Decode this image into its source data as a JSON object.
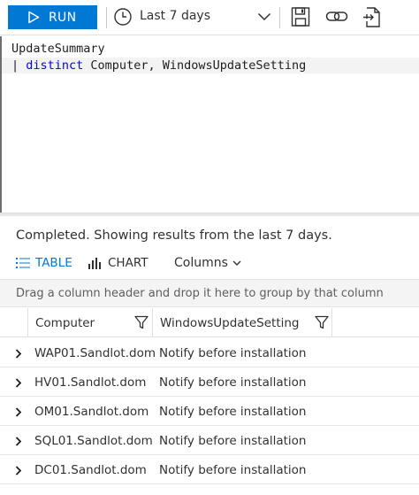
{
  "toolbar": {
    "run_label": "RUN",
    "time_range": "Last 7 days",
    "icons": [
      "play-icon",
      "clock-icon",
      "chevron-down-icon",
      "save-icon",
      "link-icon",
      "export-icon"
    ]
  },
  "editor": {
    "line1": "UpdateSummary",
    "line2_pipe": "| ",
    "line2_keyword": "distinct",
    "line2_rest": " Computer, WindowsUpdateSetting"
  },
  "results": {
    "status": "Completed. Showing results from the last 7 days.",
    "tabs": {
      "table": "TABLE",
      "chart": "CHART",
      "columns": "Columns"
    },
    "group_hint": "Drag a column header and drop it here to group by that column",
    "columns": [
      "Computer",
      "WindowsUpdateSetting"
    ],
    "rows": [
      {
        "computer": "WAP01.Sandlot.dom",
        "setting": "Notify before installation"
      },
      {
        "computer": "HV01.Sandlot.dom",
        "setting": "Notify before installation"
      },
      {
        "computer": "OM01.Sandlot.dom",
        "setting": "Notify before installation"
      },
      {
        "computer": "SQL01.Sandlot.dom",
        "setting": "Notify before installation"
      },
      {
        "computer": "DC01.Sandlot.dom",
        "setting": "Notify before installation"
      }
    ]
  },
  "colors": {
    "accent": "#0078d4",
    "keyword": "#0000ff"
  }
}
